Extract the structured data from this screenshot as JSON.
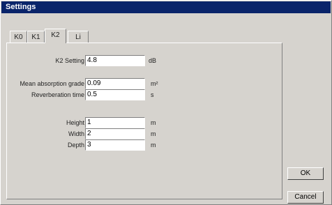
{
  "window": {
    "title": "Settings"
  },
  "tabs": [
    {
      "label": "K0"
    },
    {
      "label": "K1"
    },
    {
      "label": "K2"
    },
    {
      "label": "Li"
    }
  ],
  "fields": {
    "k2_setting": {
      "label": "K2 Setting",
      "value": "4.8",
      "unit": "dB"
    },
    "mean_absorption_grade": {
      "label": "Mean absorption grade",
      "value": "0.09",
      "unit": "m²"
    },
    "reverberation_time": {
      "label": "Reverberation time",
      "value": "0.5",
      "unit": "s"
    },
    "height": {
      "label": "Height",
      "value": "1",
      "unit": "m"
    },
    "width": {
      "label": "Width",
      "value": "2",
      "unit": "m"
    },
    "depth": {
      "label": "Depth",
      "value": "3",
      "unit": "m"
    }
  },
  "buttons": {
    "ok": "OK",
    "cancel": "Cancel"
  }
}
